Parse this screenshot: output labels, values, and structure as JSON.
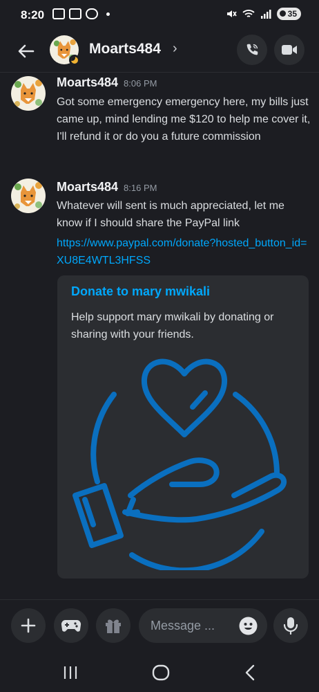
{
  "status": {
    "time": "8:20",
    "battery": "35"
  },
  "header": {
    "name": "Moarts484",
    "chevron": "›"
  },
  "messages": [
    {
      "author": "Moarts484",
      "time": "8:06 PM",
      "text": "Got some emergency emergency here,  my bills just came up, mind lending me $120 to help me cover it, I'll refund it or do you a future commission"
    },
    {
      "author": "Moarts484",
      "time": "8:16 PM",
      "text": "Whatever will sent is much appreciated, let me know if I should share the PayPal link",
      "link": "https://www.paypal.com/donate?hosted_button_id=XU8E4WTL3HFSS"
    }
  ],
  "embed": {
    "title": "Donate to mary mwikali",
    "description": "Help support mary mwikali by donating or sharing with your friends."
  },
  "input": {
    "placeholder": "Message ..."
  },
  "colors": {
    "accent": "#00a8fc",
    "illustration": "#0a6fbf",
    "background": "#1c1d22",
    "surface": "#2b2d31",
    "idle": "#f0b232"
  },
  "icons": [
    "back-arrow-icon",
    "chevron-right-icon",
    "phone-icon",
    "video-icon",
    "plus-icon",
    "gamepad-icon",
    "gift-icon",
    "emoji-icon",
    "microphone-icon",
    "recents-icon",
    "home-icon",
    "nav-back-icon"
  ]
}
